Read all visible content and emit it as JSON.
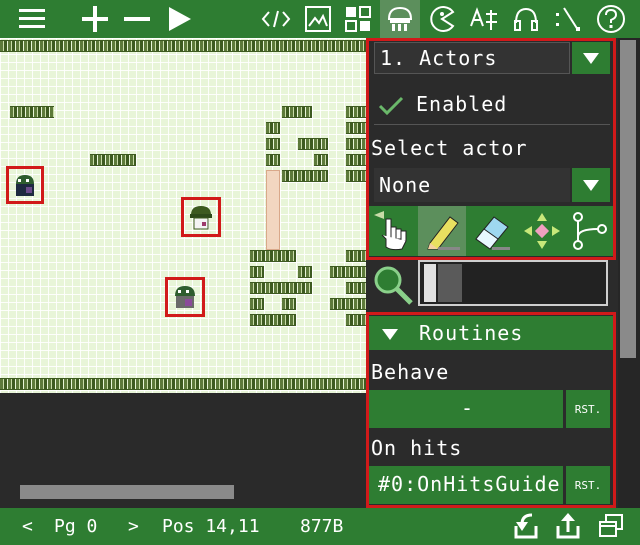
{
  "toolbar": {
    "buttons": [
      {
        "name": "menu-icon"
      },
      {
        "name": "plus-icon"
      },
      {
        "name": "minus-icon"
      },
      {
        "name": "play-icon"
      },
      {
        "name": "code-icon"
      },
      {
        "name": "image-icon"
      },
      {
        "name": "tiles-icon"
      },
      {
        "name": "actors-icon",
        "active": true
      },
      {
        "name": "pacman-icon"
      },
      {
        "name": "font-icon"
      },
      {
        "name": "headphones-icon"
      },
      {
        "name": "script-icon"
      },
      {
        "name": "help-icon"
      }
    ]
  },
  "panel": {
    "section_select": "1. Actors",
    "enabled_label": "Enabled",
    "select_actor_label": "Select actor",
    "actor_value": "None",
    "tools": [
      "hand-icon",
      "pencil-icon",
      "eraser-icon",
      "move-icon",
      "branch-icon"
    ],
    "routines_label": "Routines",
    "behave_label": "Behave",
    "behave_value": "-",
    "rst_label": "RST.",
    "on_hits_label": "On hits",
    "on_hits_value": "#0:OnHitsGuide"
  },
  "status": {
    "prev": "<",
    "page": "Pg 0",
    "next": ">",
    "pos": "Pos 14,11",
    "size": "877B"
  },
  "colors": {
    "accent": "#2e7d32",
    "highlight": "#d11a1a",
    "map_bg": "#e8f5d8"
  }
}
